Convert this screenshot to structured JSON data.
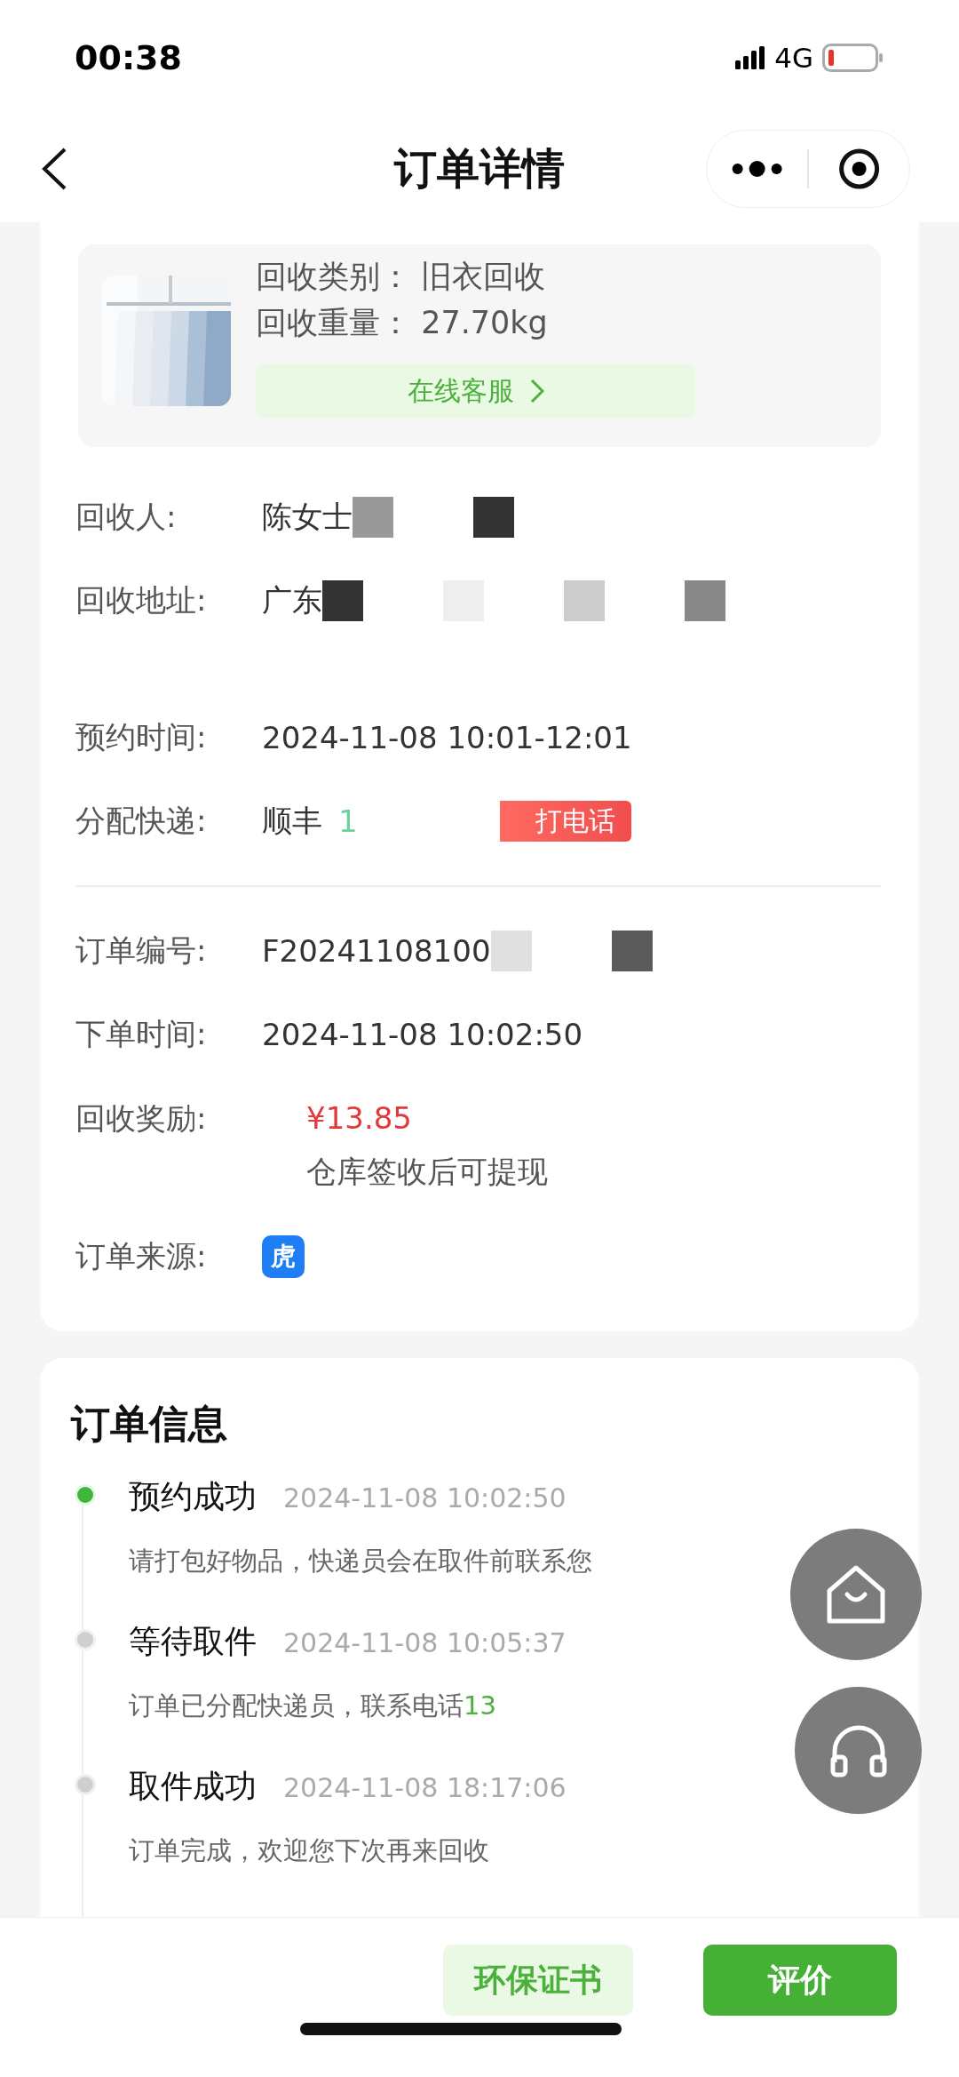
{
  "status_bar": {
    "time": "00:38",
    "network": "4G"
  },
  "nav": {
    "title": "订单详情"
  },
  "goods": {
    "kind": "picture",
    "lines": [
      {
        "label": "回收类别：",
        "value": "旧衣回收"
      },
      {
        "label": "回收重量：",
        "value": "27.70kg"
      }
    ],
    "service_button": "在线客服"
  },
  "contact_rows": [
    {
      "label": "回收人:",
      "value": "陈女士",
      "masks": [
        {
          "color": "#999999"
        },
        {
          "color": "#333333"
        }
      ]
    },
    {
      "label": "回收地址:",
      "value": "广东",
      "masks": [
        {
          "color": "#333333"
        },
        {
          "color": "#eeeeee"
        },
        {
          "color": "#cccccc"
        },
        {
          "color": "#888888"
        }
      ]
    },
    {
      "label": "预约时间:",
      "value": "2024-11-08 10:01-12:01"
    },
    {
      "label": "分配快递:",
      "value": "顺丰",
      "phone": "1",
      "call_button": "打电话"
    }
  ],
  "order_rows": [
    {
      "label": "订单编号:",
      "value": "F20241108100",
      "masks": [
        {
          "color": "#e0e0e0"
        },
        {
          "color": "#5a5a5a"
        }
      ]
    },
    {
      "label": "下单时间:",
      "value": "2024-11-08 10:02:50"
    },
    {
      "label": "回收奖励:",
      "amount": "¥13.85",
      "note": "仓库签收后可提现"
    },
    {
      "label": "订单来源:",
      "source_badge": "虎"
    }
  ],
  "timeline": {
    "title": "订单信息",
    "events": [
      {
        "title": "预约成功",
        "time": "2024-11-08 10:02:50",
        "detail": "请打包好物品，快递员会在取件前联系您",
        "current": true
      },
      {
        "title": "等待取件",
        "time": "2024-11-08 10:05:37",
        "detail": "订单已分配快递员，联系电话",
        "phone": "13",
        "current": false
      },
      {
        "title": "取件成功",
        "time": "2024-11-08 18:17:06",
        "detail": "订单完成，欢迎您下次再来回收",
        "current": false
      }
    ]
  },
  "bottom_buttons": [
    {
      "label": "环保证书",
      "kind": "secondary"
    },
    {
      "label": "评价",
      "kind": "primary"
    }
  ]
}
